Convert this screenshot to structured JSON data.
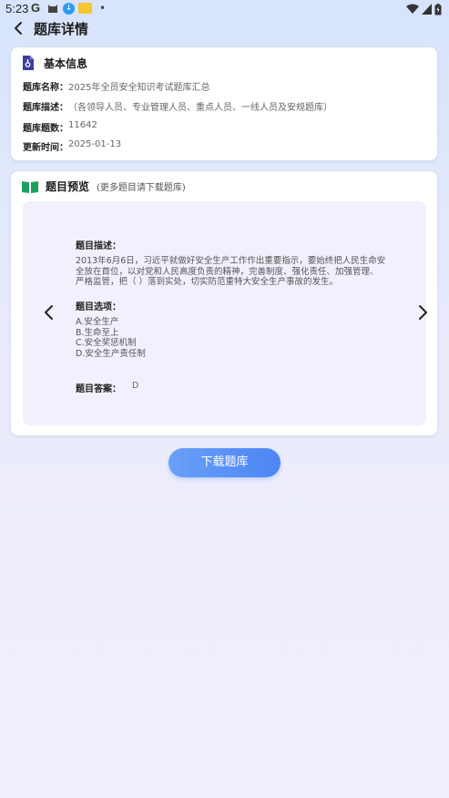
{
  "status_bar": {
    "time": "5:23",
    "g_letter": "G",
    "dot": "•",
    "icons": [
      "google-icon",
      "android-cat-icon",
      "download-app-icon",
      "photo-icon",
      "wifi-icon",
      "signal-icon",
      "battery-icon"
    ]
  },
  "header": {
    "title": "题库详情"
  },
  "basic_info": {
    "title": "基本信息",
    "rows": [
      {
        "label": "题库名称：",
        "value": "2025年全员安全知识考试题库汇总"
      },
      {
        "label": "题库描述：",
        "value": "（各领导人员、专业管理人员、重点人员、一线人员及安规题库）"
      },
      {
        "label": "题库题数：",
        "value": "11642"
      },
      {
        "label": "更新时间：",
        "value": "2025-01-13"
      }
    ]
  },
  "preview": {
    "title": "题目预览",
    "subtitle": "(更多题目请下载题库)",
    "desc_label": "题目描述：",
    "desc_lines": [
      "2013年6月6日，习近平就做好安全生产工作作出重要指示，要始终把人民生命安",
      "全放在首位，以对党和人民高度负责的精神，完善制度、强化责任、加强管理、",
      "严格监管，把（   ）落到实处，切实防范重特大安全生产事故的发生。"
    ],
    "options_label": "题目选项：",
    "options": [
      "A.安全生产",
      "B.生命至上",
      "C.安全奖惩机制",
      "D.安全生产责任制"
    ],
    "answer_label": "题目答案：",
    "answer": "D"
  },
  "download_button": "下载题库",
  "colors": {
    "accent": "#4d85f4",
    "book_icon": "#1aa260",
    "doc_icon": "#3b3f9e"
  }
}
